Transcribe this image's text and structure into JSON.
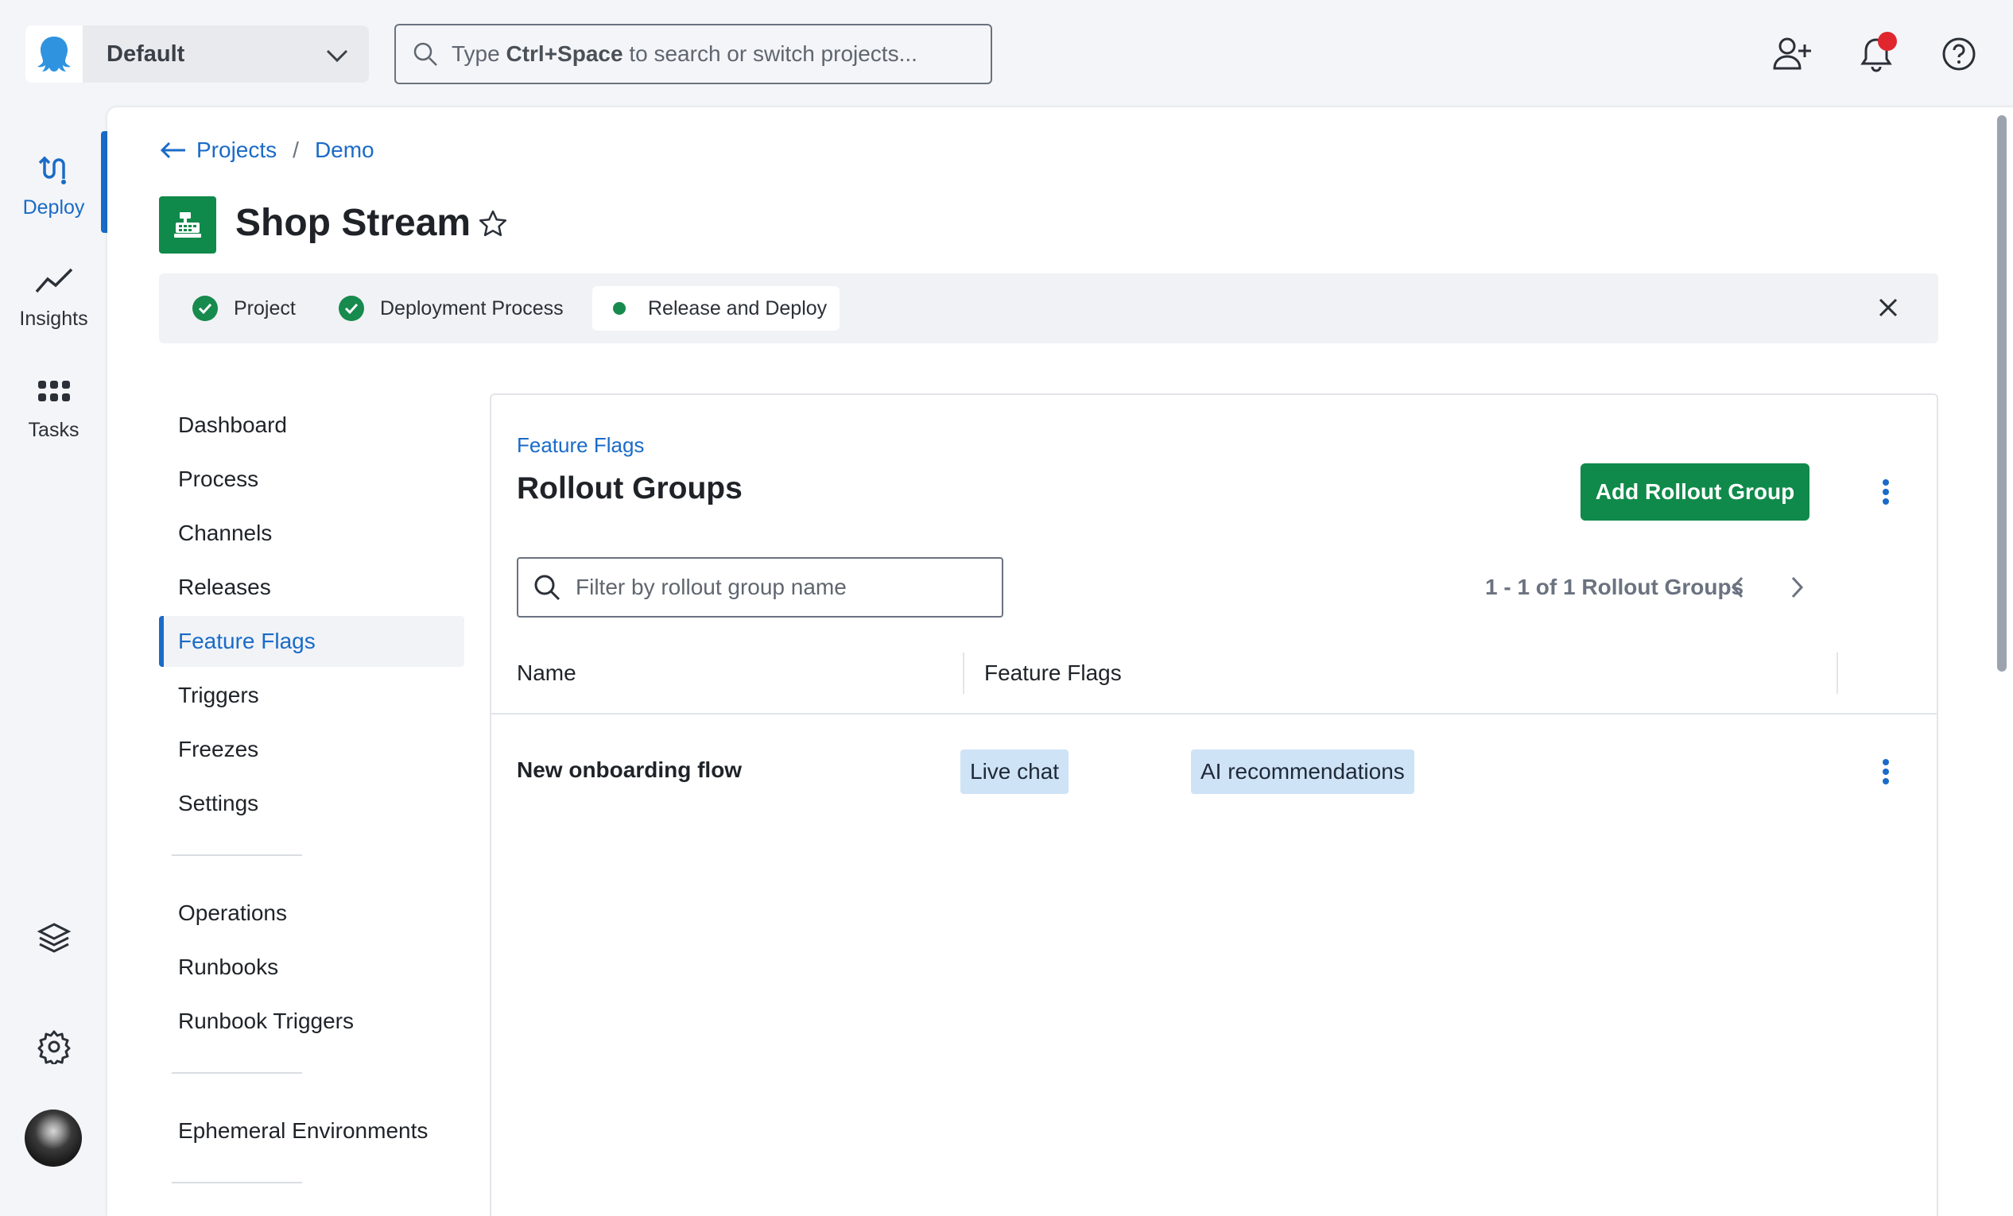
{
  "topbar": {
    "space_name": "Default",
    "search_placeholder_prefix": "Type ",
    "search_placeholder_key": "Ctrl+Space",
    "search_placeholder_suffix": " to search or switch projects..."
  },
  "leftnav": {
    "items": [
      {
        "label": "Deploy",
        "icon": "deploy-icon"
      },
      {
        "label": "Insights",
        "icon": "insights-icon"
      },
      {
        "label": "Tasks",
        "icon": "tasks-icon"
      }
    ]
  },
  "breadcrumb": {
    "items": [
      "Projects",
      "Demo"
    ],
    "separator": "/"
  },
  "project": {
    "title": "Shop Stream"
  },
  "steps": [
    {
      "label": "Project",
      "status": "done"
    },
    {
      "label": "Deployment Process",
      "status": "done"
    },
    {
      "label": "Release and Deploy",
      "status": "current"
    }
  ],
  "subnav": {
    "group1": [
      "Dashboard",
      "Process",
      "Channels",
      "Releases",
      "Feature Flags",
      "Triggers",
      "Freezes",
      "Settings"
    ],
    "group2": [
      "Operations",
      "Runbooks",
      "Runbook Triggers"
    ],
    "group3": [
      "Ephemeral Environments"
    ],
    "active": "Feature Flags"
  },
  "card": {
    "crumb": "Feature Flags",
    "title": "Rollout Groups",
    "add_button": "Add Rollout Group",
    "filter_placeholder": "Filter by rollout group name",
    "pager_text": "1 - 1 of 1 Rollout Groups",
    "columns": [
      "Name",
      "Feature Flags"
    ],
    "rows": [
      {
        "name": "New onboarding flow",
        "flags": [
          "Live chat",
          "AI recommendations"
        ]
      }
    ]
  },
  "colors": {
    "accent": "#1a6bc7",
    "primary_button": "#0f8a4a",
    "success": "#178a4d",
    "notification": "#e0272e",
    "chip_bg": "#cfe3f7"
  }
}
